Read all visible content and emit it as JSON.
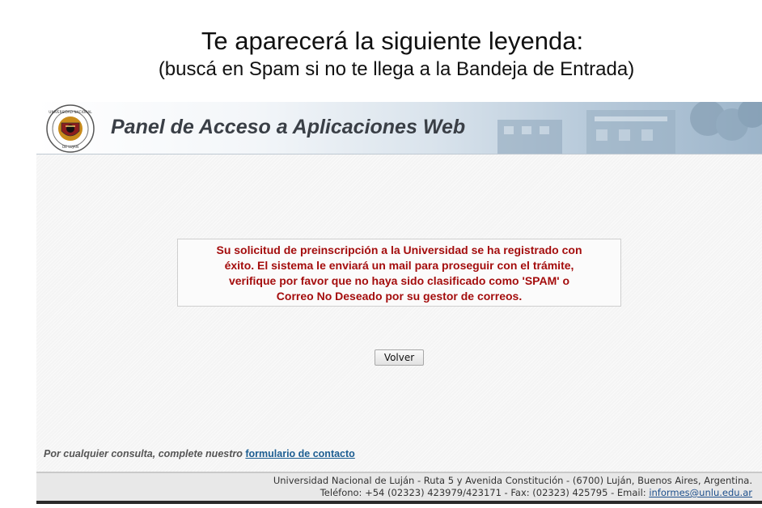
{
  "slide": {
    "title": "Te aparecerá la siguiente leyenda:",
    "subtitle": "(buscá en Spam si no te llega a la Bandeja de Entrada)"
  },
  "header": {
    "title": "Panel de Acceso a Aplicaciones Web",
    "seal_text": "UNIVERSIDAD NACIONAL DE LUJAN",
    "accent_color": "#9db5ca"
  },
  "message": {
    "lines": [
      "Su solicitud de preinscripción a la Universidad se ha registrado con",
      "éxito. El sistema le enviará un mail para proseguir con el trámite,",
      "verifique por favor que no haya sido clasificado como 'SPAM' o",
      "Correo No Deseado por su gestor de correos."
    ],
    "color": "#a40d0d"
  },
  "actions": {
    "back_label": "Volver"
  },
  "contact": {
    "prefix": "Por cualquier consulta, complete nuestro",
    "link_label": "formulario de contacto"
  },
  "footer": {
    "address": "Universidad Nacional de Luján - Ruta 5 y Avenida Constitución - (6700) Luján, Buenos Aires, Argentina.",
    "phone_prefix": "Teléfono: +54 (02323) 423979/423171 - Fax: (02323) 425795 - Email:",
    "email": "informes@unlu.edu.ar"
  }
}
